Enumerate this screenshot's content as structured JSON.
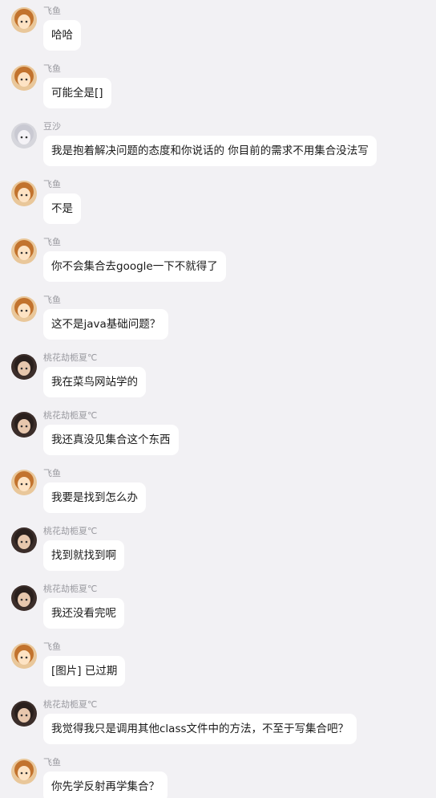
{
  "avatar_styles": {
    "feiyu": {
      "bg": "#e9c79a",
      "hair": "#c2732e",
      "face": "#fde3c4"
    },
    "dousha": {
      "bg": "#d6d6dc",
      "hair": "#c9c9d2",
      "face": "#f4f2f6"
    },
    "taohua": {
      "bg": "#3c2e2a",
      "hair": "#2a201d",
      "face": "#e7c7ad"
    }
  },
  "messages": [
    {
      "sender": "飞鱼",
      "avatar": "feiyu",
      "text": "哈哈"
    },
    {
      "sender": "飞鱼",
      "avatar": "feiyu",
      "text": "可能全是[]"
    },
    {
      "sender": "豆沙",
      "avatar": "dousha",
      "text": "我是抱着解决问题的态度和你说话的 你目前的需求不用集合没法写"
    },
    {
      "sender": "飞鱼",
      "avatar": "feiyu",
      "text": "不是"
    },
    {
      "sender": "飞鱼",
      "avatar": "feiyu",
      "text": "你不会集合去google一下不就得了"
    },
    {
      "sender": "飞鱼",
      "avatar": "feiyu",
      "text": "这不是java基础问题？"
    },
    {
      "sender": "桃花劫栀夏℃",
      "avatar": "taohua",
      "text": "我在菜鸟网站学的"
    },
    {
      "sender": "桃花劫栀夏℃",
      "avatar": "taohua",
      "text": "我还真没见集合这个东西"
    },
    {
      "sender": "飞鱼",
      "avatar": "feiyu",
      "text": "我要是找到怎么办"
    },
    {
      "sender": "桃花劫栀夏℃",
      "avatar": "taohua",
      "text": "找到就找到啊"
    },
    {
      "sender": "桃花劫栀夏℃",
      "avatar": "taohua",
      "text": "我还没看完呢"
    },
    {
      "sender": "飞鱼",
      "avatar": "feiyu",
      "text": "[图片] 已过期"
    },
    {
      "sender": "桃花劫栀夏℃",
      "avatar": "taohua",
      "text": "我觉得我只是调用其他class文件中的方法，不至于写集合吧？"
    },
    {
      "sender": "飞鱼",
      "avatar": "feiyu",
      "text": "你先学反射再学集合？"
    }
  ]
}
